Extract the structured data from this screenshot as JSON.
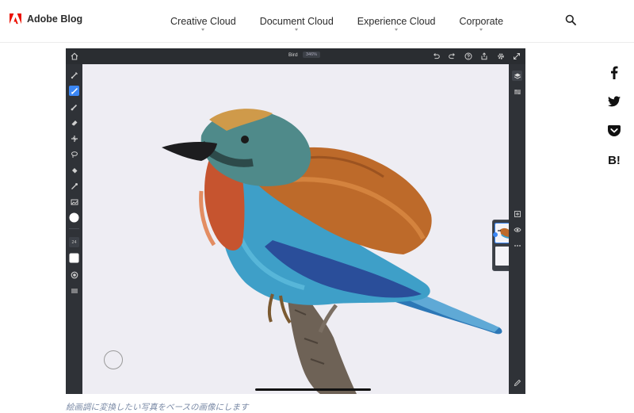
{
  "brand": {
    "name": "Adobe Blog",
    "logo_icon": "adobe-logo-icon",
    "accent": "#eb1000"
  },
  "nav": {
    "items": [
      {
        "label": "Creative Cloud"
      },
      {
        "label": "Document Cloud"
      },
      {
        "label": "Experience Cloud"
      },
      {
        "label": "Corporate"
      }
    ],
    "search_icon": "search-icon"
  },
  "share": {
    "items": [
      {
        "icon": "facebook-icon"
      },
      {
        "icon": "twitter-icon"
      },
      {
        "icon": "pocket-icon"
      },
      {
        "icon": "hatena-bookmark-icon",
        "label": "B!"
      }
    ]
  },
  "app": {
    "document_title": "Bird",
    "zoom_level": "346%",
    "toolbar_right_icons": [
      "undo-icon",
      "redo-icon",
      "help-icon",
      "share-icon",
      "settings-icon",
      "fullscreen-icon"
    ],
    "left_tools": [
      "pixel-brush-icon",
      "live-brush-icon",
      "vector-brush-icon",
      "eraser-icon",
      "smudge-icon",
      "fill-icon",
      "lasso-icon",
      "eyedropper-icon",
      "image-icon",
      "color-swatch-icon",
      "brush-size-icon",
      "color-swatch-2-icon",
      "opacity-icon",
      "settings-sliders-icon"
    ],
    "brush_size_value": "24",
    "right_tools": [
      "layers-icon",
      "properties-icon",
      "add-layer-icon",
      "visibility-icon",
      "more-icon",
      "pen-icon"
    ],
    "accent": "#3b87f5"
  },
  "caption": "絵画調に変換したい写真をベースの画像にします"
}
